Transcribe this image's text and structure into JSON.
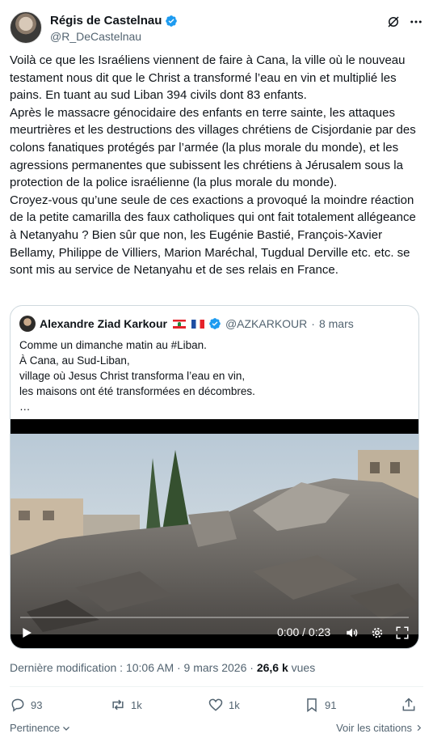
{
  "author": {
    "name": "Régis de Castelnau",
    "handle": "@R_DeCastelnau"
  },
  "tweet": {
    "text": "Voilà ce que les Israéliens viennent de faire à Cana, la ville où le nouveau testament nous dit que le Christ a transformé l’eau en vin et multiplié les pains. En tuant au sud Liban 394 civils dont 83 enfants.\nAprès le massacre génocidaire des enfants en terre sainte, les attaques meurtrières et les destructions des villages chrétiens de Cisjordanie par des colons fanatiques protégés par l’armée (la plus morale du monde), et les agressions permanentes que subissent les chrétiens à Jérusalem sous la protection de la police israélienne (la plus morale du monde).\nCroyez-vous qu’une seule de ces exactions a provoqué la moindre réaction de la petite camarilla des faux catholiques qui ont fait totalement allégeance à Netanyahu ? Bien sûr que non, les Eugénie Bastié, François-Xavier Bellamy, Philippe de Villiers, Marion Maréchal, Tugdual Derville etc. etc. se sont mis au service de Netanyahu et de ses relais en France."
  },
  "quote": {
    "name": "Alexandre Ziad Karkour",
    "handle": "@AZKARKOUR",
    "separator": "·",
    "date": "8 mars",
    "text": "Comme un dimanche matin au #Liban.\nÀ Cana, au Sud-Liban,\nvillage où Jesus Christ transforma l’eau en vin,\nles maisons ont été transformées en décombres.\n…",
    "video": {
      "time": "0:00 / 0:23",
      "progress": 0
    }
  },
  "meta": {
    "modified": "Dernière modification : 10:06 AM · 9 mars 2026 · ",
    "views_count": "26,6 k",
    "views_label": " vues"
  },
  "actions": {
    "replies": "93",
    "reposts": "1k",
    "likes": "1k",
    "bookmarks": "91"
  },
  "footer": {
    "sort_label": "Pertinence",
    "citations_label": "Voir les citations"
  },
  "colors": {
    "text": "#0f1419",
    "secondary": "#536471",
    "verified": "#1d9bf0",
    "border": "#cfd9de"
  }
}
